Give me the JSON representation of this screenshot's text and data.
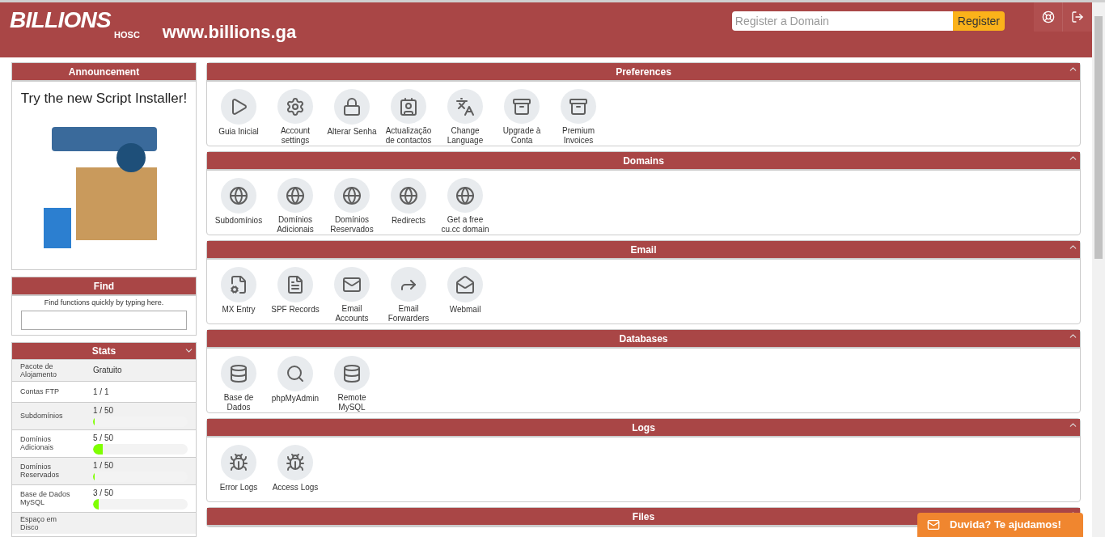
{
  "header": {
    "logo_text": "BILLIONS",
    "logo_subtext": "HOSC",
    "site": "www.billions.ga",
    "domain_search": {
      "placeholder": "Register a Domain"
    },
    "register_button": "Register"
  },
  "announcement": {
    "title": "Announcement",
    "text": "Try the new Script Installer!"
  },
  "find": {
    "title": "Find",
    "hint": "Find functions quickly by typing here."
  },
  "stats": {
    "title": "Stats",
    "rows": [
      {
        "label": "Pacote de Alojamento",
        "value": "Gratuito"
      },
      {
        "label": "Contas FTP",
        "value": "1 / 1"
      },
      {
        "label": "Subdomínios",
        "value": "1 / 50",
        "level": 0.02
      },
      {
        "label": "Domínios Adicionais",
        "value": "5 / 50",
        "level": 0.1
      },
      {
        "label": "Domínios Reservados",
        "value": "1 / 50",
        "level": 0.02
      },
      {
        "label": "Base de Dados MySQL",
        "value": "3 / 50",
        "level": 0.06
      },
      {
        "label": "Espaço em Disco"
      }
    ]
  },
  "sections": [
    {
      "title": "Preferences",
      "items": [
        "Guia Inicial",
        "Account settings",
        "Alterar Senha",
        "Actualização de contactos",
        "Change Language",
        "Upgrade à Conta",
        "Premium Invoices"
      ]
    },
    {
      "title": "Domains",
      "items": [
        "Subdomínios",
        "Domínios Adicionais",
        "Domínios Reservados",
        "Redirects",
        "Get a free cu.cc domain"
      ]
    },
    {
      "title": "Email",
      "items": [
        "MX Entry",
        "SPF Records",
        "Email Accounts",
        "Email Forwarders",
        "Webmail"
      ]
    },
    {
      "title": "Databases",
      "items": [
        "Base de Dados",
        "phpMyAdmin",
        "Remote MySQL"
      ]
    },
    {
      "title": "Logs",
      "items": [
        "Error Logs",
        "Access Logs"
      ]
    },
    {
      "title": "Files"
    }
  ],
  "chat_button": "Duvida? Te ajudamos!"
}
